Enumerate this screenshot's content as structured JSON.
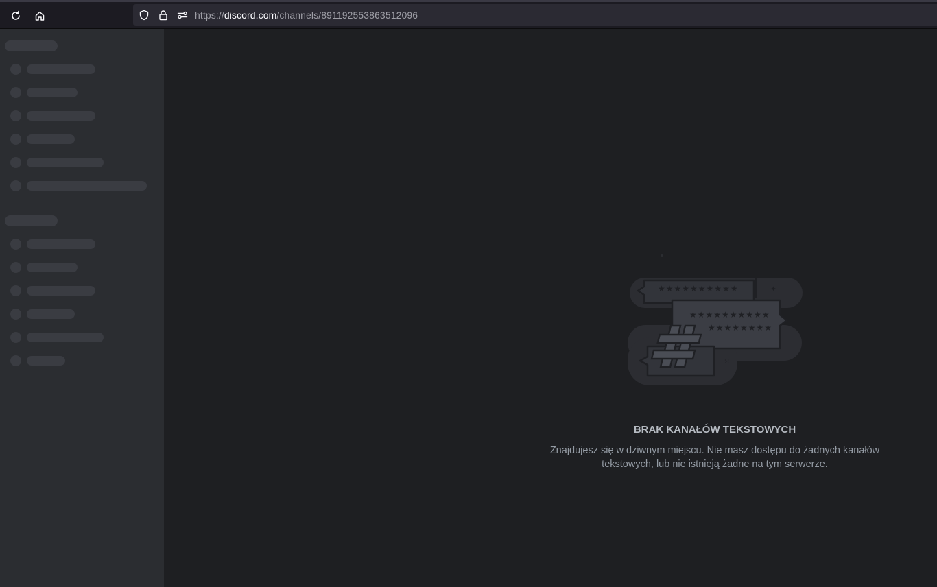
{
  "browser": {
    "url_protocol": "https://",
    "url_domain": "discord.com",
    "url_path": "/channels/891192553863512096"
  },
  "main": {
    "empty_title": "BRAK KANAŁÓW TEKSTOWYCH",
    "empty_description": "Znajdujesz się w dziwnym miejscu. Nie masz dostępu do żadnych kanałów tekstowych, lub nie istnieją żadne na tym serwerze."
  },
  "colors": {
    "app_background": "#1e1f22",
    "sidebar_background": "#2b2d31",
    "skeleton": "#3a3c42",
    "title_text": "#b5bac1",
    "description_text": "#949ba4"
  }
}
